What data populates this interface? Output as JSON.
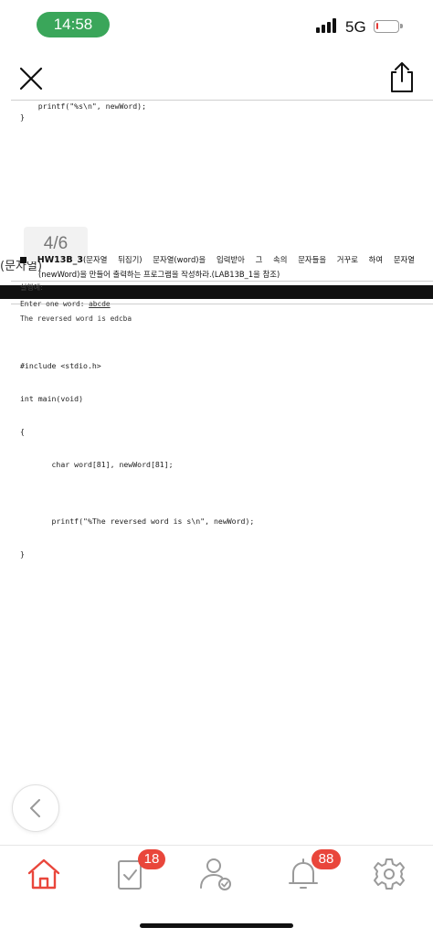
{
  "status_bar": {
    "time": "14:58",
    "network": "5G",
    "battery_level": 0.1,
    "colors": {
      "time_pill": "#3aa65a",
      "battery_low": "#e53935"
    }
  },
  "header": {
    "close_icon": "close-icon",
    "share_icon": "share-icon"
  },
  "document": {
    "prev_page_code": [
      "    printf(\"%s\\n\", newWord);",
      "}"
    ],
    "page_indicator": "4/6",
    "cut_text": "(문자열)",
    "problem": {
      "title": "HW13B_3",
      "line1_words": [
        "(문자열",
        "뒤집기)",
        "문자열(word)을",
        "입력받아",
        "그",
        "속의",
        "문자들을",
        "거꾸로",
        "하여",
        "문자열"
      ],
      "line2": "(newWord)을 만들어 출력하는 프로그램을 작성하라.(LAB13B_1을 참조)"
    },
    "run_example_label": "실행예:",
    "run_input_prompt": "Enter one word: ",
    "run_input_value": "abcde",
    "run_output": "The reversed word is edcba",
    "code_lines": [
      "#include <stdio.h>",
      "int main(void)",
      "{",
      "       char word[81], newWord[81];"
    ],
    "code_tail": [
      "       printf(\"%The reversed word is s\\n\", newWord);",
      "}"
    ]
  },
  "nav": {
    "back_icon": "chevron-left-icon"
  },
  "tab_bar": {
    "items": [
      {
        "name": "home",
        "icon": "home-icon",
        "active": true
      },
      {
        "name": "tasks",
        "icon": "clipboard-check-icon",
        "badge": "18"
      },
      {
        "name": "people",
        "icon": "user-check-icon"
      },
      {
        "name": "notifications",
        "icon": "bell-icon",
        "badge": "88"
      },
      {
        "name": "settings",
        "icon": "gear-icon"
      }
    ],
    "accent": "#e9463b"
  }
}
